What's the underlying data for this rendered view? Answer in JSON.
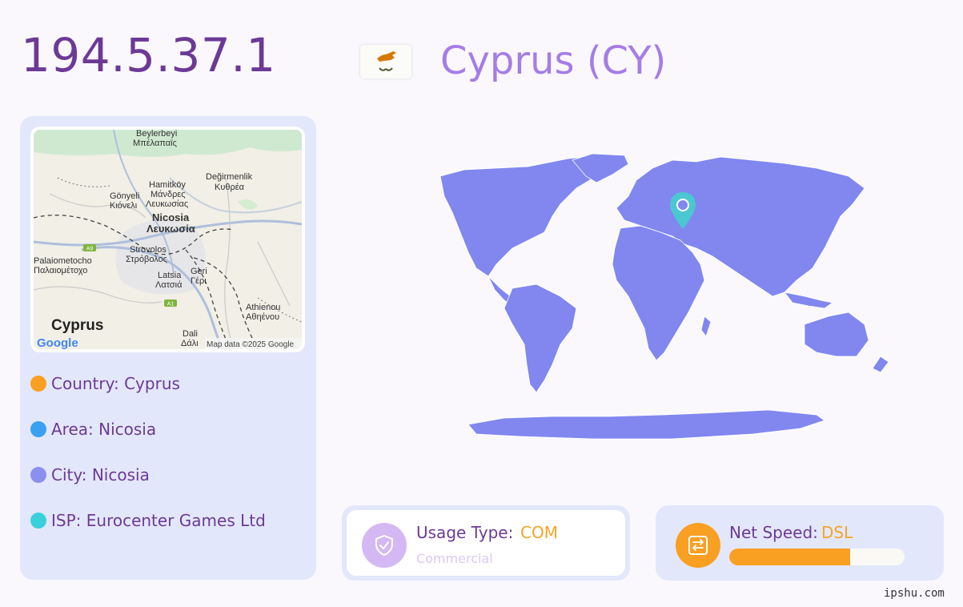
{
  "header": {
    "ip": "194.5.37.1",
    "country_title": "Cyprus (CY)"
  },
  "mini_map": {
    "labels": {
      "beylerbeyi": "Beylerbeyi",
      "beylerbeyi_gr": "Μπέλαπαϊς",
      "hamitkoy": "Hamitköy",
      "hamitkoy_gr1": "Μάνδρες",
      "hamitkoy_gr2": "Λευκωσίας",
      "degirmenlik": "Değirmenlik",
      "degirmenlik_gr": "Κυθρέα",
      "gonyeli": "Gönyeli",
      "gonyeli_gr": "Κιόνελι",
      "nicosia": "Nicosia",
      "nicosia_gr": "Λευκωσία",
      "strovolos": "Strovolos",
      "strovolos_gr": "Στρόβολος",
      "palaiometocho": "Palaiometocho",
      "palaiometocho_gr": "Παλαιομέτοχο",
      "latsia": "Latsia",
      "latsia_gr": "Λατσιά",
      "geri": "Geri",
      "geri_gr": "Γέρι",
      "athienou": "Athienou",
      "athienou_gr": "Αθηένου",
      "dali": "Dali",
      "dali_gr": "Δάλι",
      "cyprus": "Cyprus",
      "google": "Google",
      "attribution": "Map data ©2025 Google",
      "a9": "A9",
      "a1": "A1"
    }
  },
  "info": {
    "country": "Country: Cyprus",
    "area": "Area: Nicosia",
    "city": "City: Nicosia",
    "isp": "ISP: Eurocenter Games Ltd"
  },
  "usage": {
    "label": "Usage Type:",
    "value": "COM",
    "sub": "Commercial"
  },
  "speed": {
    "label": "Net Speed:",
    "value": "DSL",
    "level_percent": 69
  },
  "watermark": "ipshu.com",
  "colors": {
    "title": "#6c3a96",
    "country_title": "#a57de6",
    "panel_bg": "#e3e7fb",
    "dot_country": "#f99f22",
    "dot_area": "#3aa0f2",
    "dot_city": "#8b8ff0",
    "dot_isp": "#3bcfdc",
    "world_fill": "#8187ef",
    "pin": "#4bc7d2",
    "accent_value": "#f5a524"
  },
  "icons": {
    "usage": "shield-check-icon",
    "speed": "network-transfer-icon",
    "map_marker": "map-pin-icon"
  }
}
